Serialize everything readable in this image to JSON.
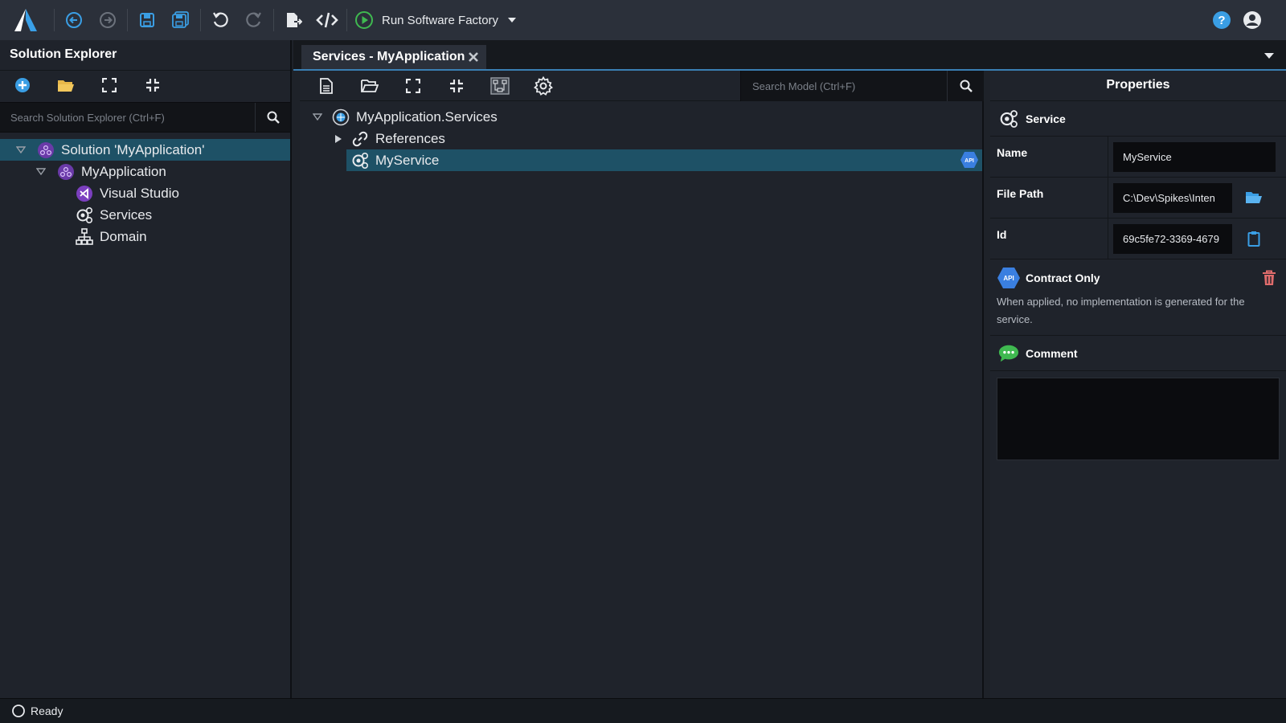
{
  "toolbar": {
    "run_label": "Run Software Factory",
    "icons": [
      "logo-icon",
      "back-icon",
      "forward-icon",
      "save-icon",
      "save-all-icon",
      "undo-icon",
      "redo-icon",
      "export-icon",
      "code-icon",
      "play-icon",
      "help-icon",
      "user-icon"
    ]
  },
  "solution_explorer": {
    "title": "Solution Explorer",
    "search_placeholder": "Search Solution Explorer (Ctrl+F)",
    "tree": [
      {
        "label": "Solution 'MyApplication'",
        "icon": "solution-icon",
        "selected": true
      },
      {
        "label": "MyApplication",
        "icon": "application-icon"
      },
      {
        "label": "Visual Studio",
        "icon": "visual-studio-icon"
      },
      {
        "label": "Services",
        "icon": "services-icon"
      },
      {
        "label": "Domain",
        "icon": "domain-icon"
      }
    ]
  },
  "editor": {
    "tab_label": "Services - MyApplication",
    "search_placeholder": "Search Model (Ctrl+F)",
    "tree": [
      {
        "label": "MyApplication.Services",
        "icon": "package-icon"
      },
      {
        "label": "References",
        "icon": "link-icon"
      },
      {
        "label": "MyService",
        "icon": "service-icon",
        "selected": true,
        "badge": "API"
      }
    ]
  },
  "properties": {
    "title": "Properties",
    "section": "Service",
    "rows": [
      {
        "label": "Name",
        "value": "MyService"
      },
      {
        "label": "File Path",
        "value": "C:\\Dev\\Spikes\\Inten"
      },
      {
        "label": "Id",
        "value": "69c5fe72-3369-4679"
      }
    ],
    "stereotype": {
      "badge": "API",
      "title": "Contract Only",
      "description": "When applied, no implementation is generated for the service."
    },
    "comment_title": "Comment"
  },
  "status": {
    "text": "Ready"
  },
  "colors": {
    "accent": "#3a9ee4",
    "selection": "#1e5166",
    "purple": "#6a3aa8",
    "green": "#3fb950",
    "delete": "#e06c6c"
  }
}
